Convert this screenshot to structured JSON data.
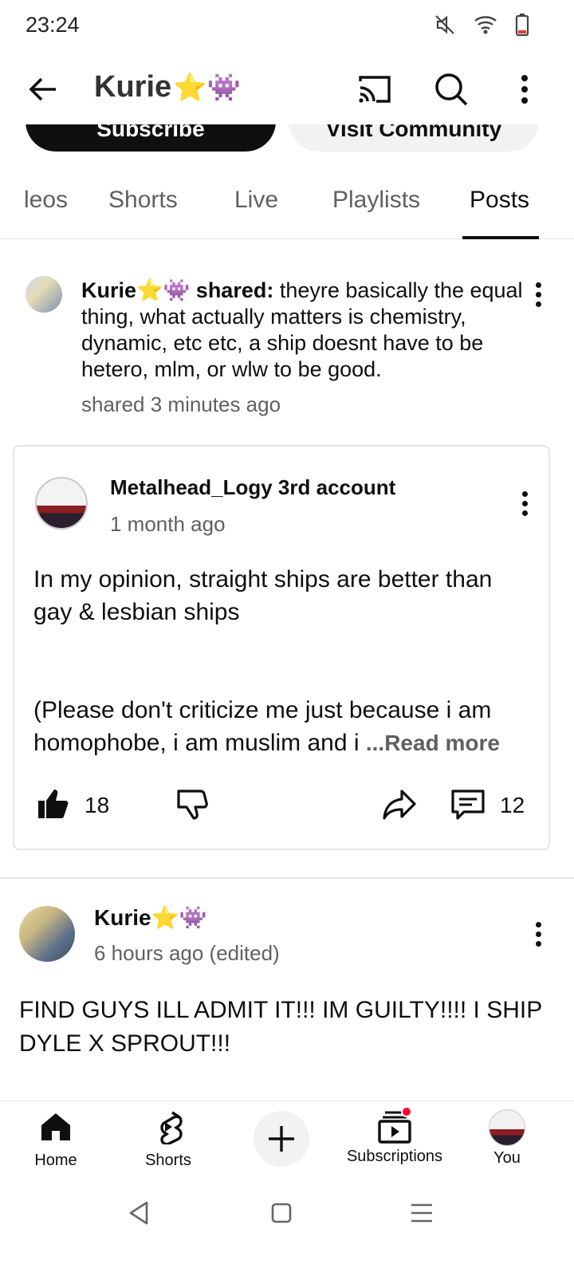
{
  "status_bar": {
    "time": "23:24"
  },
  "header": {
    "channel_name": "Kurie",
    "channel_emojis": "⭐👾"
  },
  "actions": {
    "subscribe_label": "Subscribe",
    "community_label": "Visit Community"
  },
  "tabs": [
    {
      "label": "Videos",
      "visible_label": "leos"
    },
    {
      "label": "Shorts"
    },
    {
      "label": "Live"
    },
    {
      "label": "Playlists"
    },
    {
      "label": "Posts",
      "active": true
    }
  ],
  "shared_post": {
    "author": "Kurie",
    "author_emojis": "⭐👾",
    "shared_label": "shared:",
    "text": "theyre basically the equal thing, what actually matters is chemistry, dynamic, etc etc, a ship doesnt have to be hetero, mlm, or wlw to be good.",
    "time": "shared 3 minutes ago",
    "original": {
      "author": "Metalhead_Logy 3rd account",
      "time": "1 month ago",
      "body_line1": "In my opinion, straight ships are better than gay & lesbian ships",
      "body_line2": "(Please don't criticize me just because i am homophobe, i am muslim and i",
      "read_more": "...Read more",
      "likes": "18",
      "comments": "12"
    }
  },
  "post2": {
    "author": "Kurie",
    "author_emojis": "⭐👾",
    "time": "6 hours ago (edited)",
    "body": "FIND GUYS ILL ADMIT IT!!! IM GUILTY!!!! I SHIP DYLE X SPROUT!!!"
  },
  "bottom_nav": {
    "home": "Home",
    "shorts": "Shorts",
    "subscriptions": "Subscriptions",
    "you": "You"
  },
  "colors": {
    "accent": "#0f0f0f",
    "secondary_text": "#606060",
    "notification": "#ff0033"
  }
}
